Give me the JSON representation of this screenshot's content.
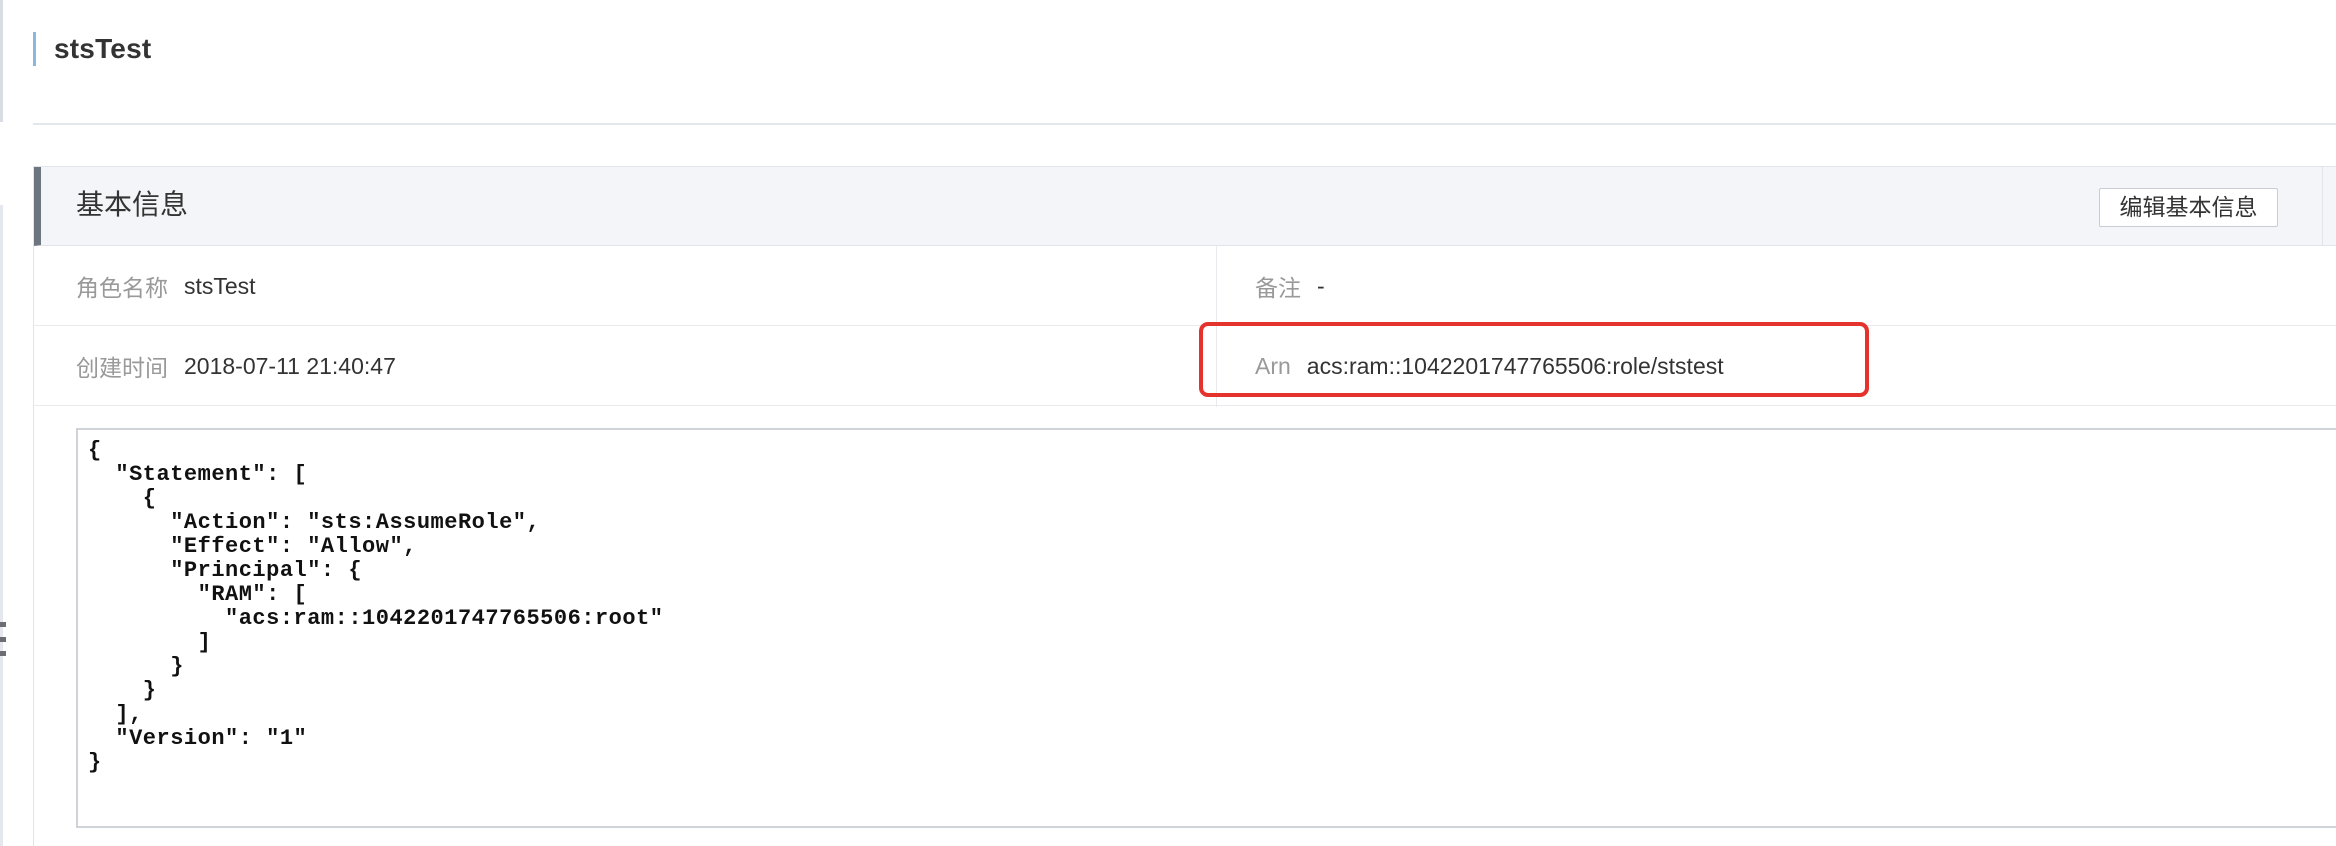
{
  "header": {
    "title": "stsTest"
  },
  "panel": {
    "title": "基本信息",
    "edit_button_label": "编辑基本信息"
  },
  "fields": {
    "role_name": {
      "label": "角色名称",
      "value": "stsTest"
    },
    "note": {
      "label": "备注",
      "value": "-"
    },
    "created": {
      "label": "创建时间",
      "value": "2018-07-11 21:40:47"
    },
    "arn": {
      "label": "Arn",
      "value": "acs:ram::1042201747765506:role/ststest"
    }
  },
  "policy": {
    "document": "{\n  \"Statement\": [\n    {\n      \"Action\": \"sts:AssumeRole\",\n      \"Effect\": \"Allow\",\n      \"Principal\": {\n        \"RAM\": [\n          \"acs:ram::1042201747765506:root\"\n        ]\n      }\n    }\n  ],\n  \"Version\": \"1\"\n}"
  },
  "colors": {
    "highlight": "#e4332c",
    "accent_bar": "#88b7e0",
    "panel_head_bar": "#6c7580"
  }
}
